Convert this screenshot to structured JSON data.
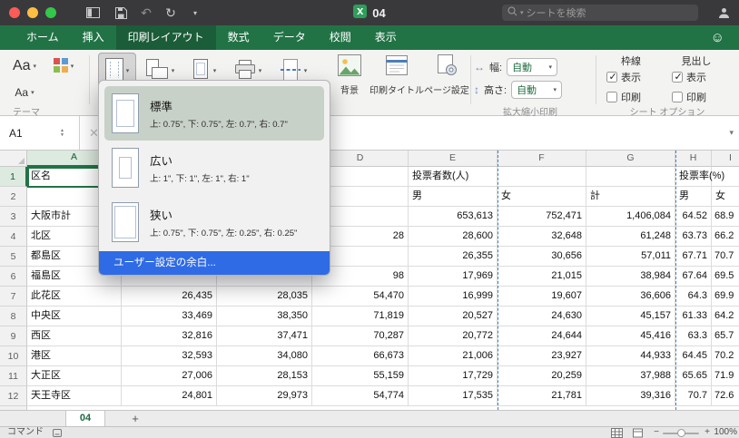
{
  "window": {
    "title": "04",
    "search_placeholder": "シートを検索"
  },
  "ribbon_tabs": [
    {
      "label": "ホーム",
      "active": false
    },
    {
      "label": "挿入",
      "active": false
    },
    {
      "label": "印刷レイアウト",
      "active": true
    },
    {
      "label": "数式",
      "active": false
    },
    {
      "label": "データ",
      "active": false
    },
    {
      "label": "校閲",
      "active": false
    },
    {
      "label": "表示",
      "active": false
    }
  ],
  "ribbon": {
    "themes": {
      "label": "テーマ",
      "theme_button": "Aa",
      "font_button": "Aa"
    },
    "page_setup": {
      "background": "背景",
      "print_titles": "印刷タイトル",
      "page_settings": "ページ設定"
    },
    "scale": {
      "width_label": "幅:",
      "width_value": "自動",
      "height_label": "高さ:",
      "height_value": "自動",
      "group_label": "拡大縮小印刷"
    },
    "sheet_options": {
      "gridlines_label": "枠線",
      "headings_label": "見出し",
      "view_label": "表示",
      "print_label": "印刷",
      "gridlines_view_checked": true,
      "gridlines_print_checked": false,
      "headings_view_checked": true,
      "headings_print_checked": false,
      "group_label": "シート オプション"
    }
  },
  "margins_menu": {
    "items": [
      {
        "name": "標準",
        "detail": "上: 0.75\", 下: 0.75\", 左: 0.7\", 右: 0.7\"",
        "selected": true,
        "icon": "margin-normal-icon"
      },
      {
        "name": "広い",
        "detail": "上: 1\", 下: 1\", 左: 1\", 右: 1\"",
        "selected": false,
        "icon": "margin-wide-icon"
      },
      {
        "name": "狭い",
        "detail": "上: 0.75\", 下: 0.75\", 左: 0.25\", 右: 0.25\"",
        "selected": false,
        "icon": "margin-narrow-icon"
      }
    ],
    "custom_label": "ユーザー設定の余白..."
  },
  "formula_bar": {
    "name_box": "A1"
  },
  "grid": {
    "columns": [
      "A",
      "B",
      "C",
      "D",
      "E",
      "F",
      "G",
      "H",
      "I"
    ],
    "rows": [
      {
        "n": "1",
        "cells": {
          "A": "区名",
          "E": "投票者数(人)",
          "H": "投票率(%)"
        }
      },
      {
        "n": "2",
        "cells": {
          "E": "男",
          "F": "女",
          "G": "計",
          "H": "男",
          "I": "女"
        }
      },
      {
        "n": "3",
        "cells": {
          "A": "大阪市計",
          "E": "653,613",
          "F": "752,471",
          "G": "1,406,084",
          "H": "64.52",
          "I": "68.9"
        }
      },
      {
        "n": "4",
        "cells": {
          "A": "北区",
          "D": "28",
          "E": "28,600",
          "F": "32,648",
          "G": "61,248",
          "H": "63.73",
          "I": "66.2"
        }
      },
      {
        "n": "5",
        "cells": {
          "A": "都島区",
          "E": "26,355",
          "F": "30,656",
          "G": "57,011",
          "H": "67.71",
          "I": "70.7"
        }
      },
      {
        "n": "6",
        "cells": {
          "A": "福島区",
          "D": "98",
          "E": "17,969",
          "F": "21,015",
          "G": "38,984",
          "H": "67.64",
          "I": "69.5"
        }
      },
      {
        "n": "7",
        "cells": {
          "A": "此花区",
          "B": "26,435",
          "C": "28,035",
          "D": "54,470",
          "E": "16,999",
          "F": "19,607",
          "G": "36,606",
          "H": "64.3",
          "I": "69.9"
        }
      },
      {
        "n": "8",
        "cells": {
          "A": "中央区",
          "B": "33,469",
          "C": "38,350",
          "D": "71,819",
          "E": "20,527",
          "F": "24,630",
          "G": "45,157",
          "H": "61.33",
          "I": "64.2"
        }
      },
      {
        "n": "9",
        "cells": {
          "A": "西区",
          "B": "32,816",
          "C": "37,471",
          "D": "70,287",
          "E": "20,772",
          "F": "24,644",
          "G": "45,416",
          "H": "63.3",
          "I": "65.7"
        }
      },
      {
        "n": "10",
        "cells": {
          "A": "港区",
          "B": "32,593",
          "C": "34,080",
          "D": "66,673",
          "E": "21,006",
          "F": "23,927",
          "G": "44,933",
          "H": "64.45",
          "I": "70.2"
        }
      },
      {
        "n": "11",
        "cells": {
          "A": "大正区",
          "B": "27,006",
          "C": "28,153",
          "D": "55,159",
          "E": "17,729",
          "F": "20,259",
          "G": "37,988",
          "H": "65.65",
          "I": "71.9"
        }
      },
      {
        "n": "12",
        "cells": {
          "A": "天王寺区",
          "B": "24,801",
          "C": "29,973",
          "D": "54,774",
          "E": "17,535",
          "F": "21,781",
          "G": "39,316",
          "H": "70.7",
          "I": "72.6"
        }
      }
    ]
  },
  "sheet_tabs": {
    "active": "04",
    "add_label": "+"
  },
  "status_bar": {
    "mode": "コマンド",
    "zoom": "100%"
  },
  "colors": {
    "excel_green": "#217346",
    "menu_highlight_blue": "#2f6be4",
    "page_break_blue": "#4a7ebb"
  }
}
